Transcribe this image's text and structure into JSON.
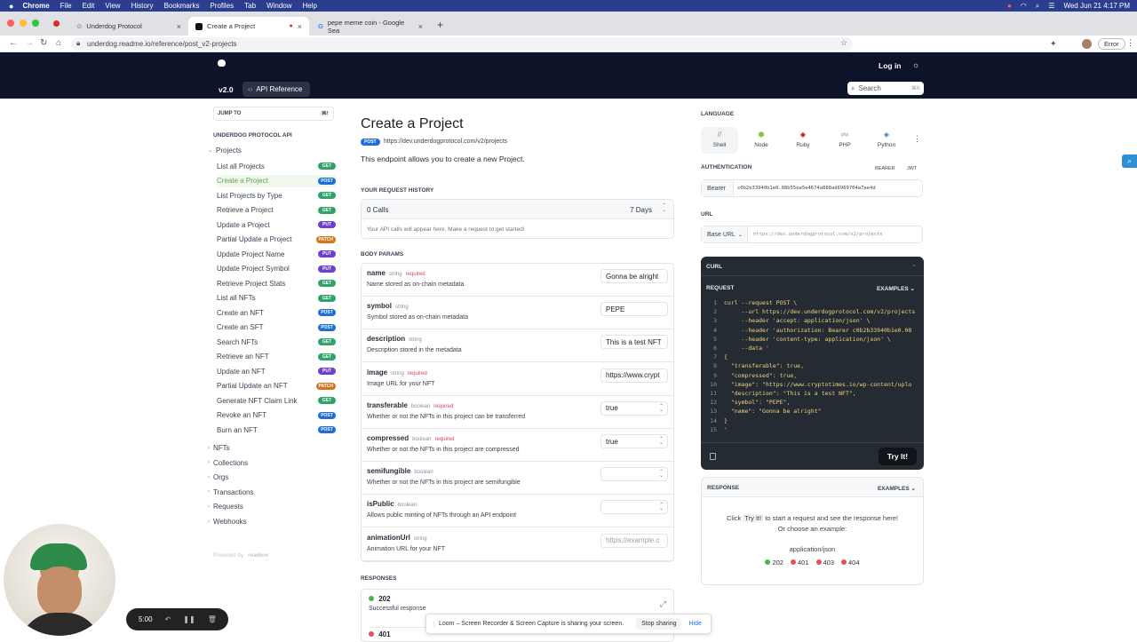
{
  "menubar": {
    "app": "Chrome",
    "items": [
      "File",
      "Edit",
      "View",
      "History",
      "Bookmarks",
      "Profiles",
      "Tab",
      "Window",
      "Help"
    ],
    "datetime": "Wed Jun 21  4:17 PM"
  },
  "tabs": [
    {
      "title": "Underdog Protocol"
    },
    {
      "title": "Create a Project"
    },
    {
      "title": "pepe meme coin - Google Sea"
    }
  ],
  "browser": {
    "url": "underdog.readme.io/reference/post_v2-projects",
    "error_label": "Error"
  },
  "site": {
    "version": "v2.0",
    "api_reference": "API Reference",
    "login": "Log in",
    "search_placeholder": "Search",
    "search_shortcut": "⌘K"
  },
  "sidebar": {
    "jump_to": "JUMP TO",
    "jump_shortcut": "⌘/",
    "section": "UNDERDOG PROTOCOL API",
    "projects_label": "Projects",
    "items": [
      {
        "label": "List all Projects",
        "method": "GET"
      },
      {
        "label": "Create a Project",
        "method": "POST"
      },
      {
        "label": "List Projects by Type",
        "method": "GET"
      },
      {
        "label": "Retrieve a Project",
        "method": "GET"
      },
      {
        "label": "Update a Project",
        "method": "PUT"
      },
      {
        "label": "Partial Update a Project",
        "method": "PATCH"
      },
      {
        "label": "Update Project Name",
        "method": "PUT"
      },
      {
        "label": "Update Project Symbol",
        "method": "PUT"
      },
      {
        "label": "Retrieve Project Stats",
        "method": "GET"
      },
      {
        "label": "List all NFTs",
        "method": "GET"
      },
      {
        "label": "Create an NFT",
        "method": "POST"
      },
      {
        "label": "Create an SFT",
        "method": "POST"
      },
      {
        "label": "Search NFTs",
        "method": "GET"
      },
      {
        "label": "Retrieve an NFT",
        "method": "GET"
      },
      {
        "label": "Update an NFT",
        "method": "PUT"
      },
      {
        "label": "Partial Update an NFT",
        "method": "PATCH"
      },
      {
        "label": "Generate NFT Claim Link",
        "method": "GET"
      },
      {
        "label": "Revoke an NFT",
        "method": "POST"
      },
      {
        "label": "Burn an NFT",
        "method": "POST"
      }
    ],
    "groups": [
      "NFTs",
      "Collections",
      "Orgs",
      "Transactions",
      "Requests",
      "Webhooks"
    ],
    "powered_by": "Powered by",
    "powered_brand": "readme"
  },
  "main": {
    "title": "Create a Project",
    "method": "POST",
    "endpoint": "https://dev.underdogprotocol.com/v2/projects",
    "description": "This endpoint allows you to create a new Project.",
    "history_heading": "YOUR REQUEST HISTORY",
    "calls": "0 Calls",
    "days": "7 Days",
    "history_note": "Your API calls will appear here. Make a request to get started!",
    "body_params": "BODY PARAMS",
    "params": [
      {
        "name": "name",
        "type": "string",
        "required": "required",
        "desc": "Name stored as on-chain metadata",
        "value": "Gonna be alright",
        "select": false,
        "placeholder": false
      },
      {
        "name": "symbol",
        "type": "string",
        "required": "",
        "desc": "Symbol stored as on-chain metadata",
        "value": "PEPE",
        "select": false,
        "placeholder": false
      },
      {
        "name": "description",
        "type": "string",
        "required": "",
        "desc": "Description stored in the metadata",
        "value": "This is a test NFT",
        "select": false,
        "placeholder": false
      },
      {
        "name": "image",
        "type": "string",
        "required": "required",
        "desc": "Image URL for your NFT",
        "value": "https://www.crypt",
        "select": false,
        "placeholder": false
      },
      {
        "name": "transferable",
        "type": "boolean",
        "required": "required",
        "desc": "Whether or not the NFTs in this project can be transferred",
        "value": "true",
        "select": true,
        "placeholder": false
      },
      {
        "name": "compressed",
        "type": "boolean",
        "required": "required",
        "desc": "Whether or not the NFTs in this project are compressed",
        "value": "true",
        "select": true,
        "placeholder": false
      },
      {
        "name": "semifungible",
        "type": "boolean",
        "required": "",
        "desc": "Whether or not the NFTs in this project are semifungible",
        "value": "",
        "select": true,
        "placeholder": false
      },
      {
        "name": "isPublic",
        "type": "boolean",
        "required": "",
        "desc": "Allows public minting of NFTs through an API endpoint",
        "value": "",
        "select": true,
        "placeholder": false
      },
      {
        "name": "animationUrl",
        "type": "string",
        "required": "",
        "desc": "Animation URL for your NFT",
        "value": "https://example.c",
        "select": false,
        "placeholder": true
      }
    ],
    "responses_heading": "RESPONSES",
    "responses": [
      {
        "code": "202",
        "desc": "Successful response"
      },
      {
        "code": "401",
        "desc": ""
      }
    ]
  },
  "right": {
    "language_heading": "LANGUAGE",
    "languages": [
      "Shell",
      "Node",
      "Ruby",
      "PHP",
      "Python"
    ],
    "auth_heading": "AUTHENTICATION",
    "auth_types": [
      "BEARER",
      "JWT"
    ],
    "bearer_label": "Bearer",
    "bearer_token": "c0b2b33940b1e0.08b55ea5e4674a888ad6969704a7ae4d",
    "url_heading": "URL",
    "base_url_label": "Base URL",
    "base_url": "https://dev.underdogprotocol.com",
    "base_url_path": "/v2/projects",
    "curl_heading": "CURL",
    "request_label": "REQUEST",
    "examples_label": "EXAMPLES",
    "code": [
      "curl --request POST \\",
      "     --url https://dev.underdogprotocol.com/v2/projects",
      "     --header 'accept: application/json' \\",
      "     --header 'authorization: Bearer c0b2b33940b1e0.08",
      "     --header 'content-type: application/json' \\",
      "     --data '",
      "{",
      "  \"transferable\": true,",
      "  \"compressed\": true,",
      "  \"image\": \"https://www.cryptotimes.io/wp-content/uplo",
      "  \"description\": \"This is a test NFT\",",
      "  \"symbol\": \"PEPE\",",
      "  \"name\": \"Gonna be alright\"",
      "}",
      "'"
    ],
    "try_it": "Try It!",
    "response_heading": "RESPONSE",
    "response_examples": "EXAMPLES",
    "response_click": "Click",
    "response_try": "Try It!",
    "response_rest": "to start a request and see the response here!",
    "response_or": "Or choose an example:",
    "content_type": "application/json",
    "codes": [
      {
        "code": "202",
        "color": "#3fb950"
      },
      {
        "code": "401",
        "color": "#e0535f"
      },
      {
        "code": "403",
        "color": "#e0535f"
      },
      {
        "code": "404",
        "color": "#e0535f"
      }
    ]
  },
  "loom": {
    "timer": "5:00",
    "message": "Loom – Screen Recorder & Screen Capture is sharing your screen.",
    "stop": "Stop sharing",
    "hide": "Hide"
  },
  "colors": {
    "get": "#2fa36b",
    "post": "#1f6fd6",
    "put": "#6b3fd1",
    "patch": "#d6741f"
  }
}
